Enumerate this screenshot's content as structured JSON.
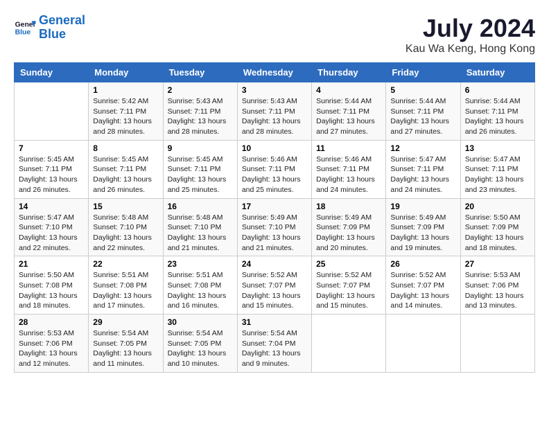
{
  "header": {
    "logo_line1": "General",
    "logo_line2": "Blue",
    "month": "July 2024",
    "location": "Kau Wa Keng, Hong Kong"
  },
  "days_of_week": [
    "Sunday",
    "Monday",
    "Tuesday",
    "Wednesday",
    "Thursday",
    "Friday",
    "Saturday"
  ],
  "weeks": [
    [
      {
        "num": "",
        "sunrise": "",
        "sunset": "",
        "daylight": ""
      },
      {
        "num": "1",
        "sunrise": "Sunrise: 5:42 AM",
        "sunset": "Sunset: 7:11 PM",
        "daylight": "Daylight: 13 hours and 28 minutes."
      },
      {
        "num": "2",
        "sunrise": "Sunrise: 5:43 AM",
        "sunset": "Sunset: 7:11 PM",
        "daylight": "Daylight: 13 hours and 28 minutes."
      },
      {
        "num": "3",
        "sunrise": "Sunrise: 5:43 AM",
        "sunset": "Sunset: 7:11 PM",
        "daylight": "Daylight: 13 hours and 28 minutes."
      },
      {
        "num": "4",
        "sunrise": "Sunrise: 5:44 AM",
        "sunset": "Sunset: 7:11 PM",
        "daylight": "Daylight: 13 hours and 27 minutes."
      },
      {
        "num": "5",
        "sunrise": "Sunrise: 5:44 AM",
        "sunset": "Sunset: 7:11 PM",
        "daylight": "Daylight: 13 hours and 27 minutes."
      },
      {
        "num": "6",
        "sunrise": "Sunrise: 5:44 AM",
        "sunset": "Sunset: 7:11 PM",
        "daylight": "Daylight: 13 hours and 26 minutes."
      }
    ],
    [
      {
        "num": "7",
        "sunrise": "Sunrise: 5:45 AM",
        "sunset": "Sunset: 7:11 PM",
        "daylight": "Daylight: 13 hours and 26 minutes."
      },
      {
        "num": "8",
        "sunrise": "Sunrise: 5:45 AM",
        "sunset": "Sunset: 7:11 PM",
        "daylight": "Daylight: 13 hours and 26 minutes."
      },
      {
        "num": "9",
        "sunrise": "Sunrise: 5:45 AM",
        "sunset": "Sunset: 7:11 PM",
        "daylight": "Daylight: 13 hours and 25 minutes."
      },
      {
        "num": "10",
        "sunrise": "Sunrise: 5:46 AM",
        "sunset": "Sunset: 7:11 PM",
        "daylight": "Daylight: 13 hours and 25 minutes."
      },
      {
        "num": "11",
        "sunrise": "Sunrise: 5:46 AM",
        "sunset": "Sunset: 7:11 PM",
        "daylight": "Daylight: 13 hours and 24 minutes."
      },
      {
        "num": "12",
        "sunrise": "Sunrise: 5:47 AM",
        "sunset": "Sunset: 7:11 PM",
        "daylight": "Daylight: 13 hours and 24 minutes."
      },
      {
        "num": "13",
        "sunrise": "Sunrise: 5:47 AM",
        "sunset": "Sunset: 7:11 PM",
        "daylight": "Daylight: 13 hours and 23 minutes."
      }
    ],
    [
      {
        "num": "14",
        "sunrise": "Sunrise: 5:47 AM",
        "sunset": "Sunset: 7:10 PM",
        "daylight": "Daylight: 13 hours and 22 minutes."
      },
      {
        "num": "15",
        "sunrise": "Sunrise: 5:48 AM",
        "sunset": "Sunset: 7:10 PM",
        "daylight": "Daylight: 13 hours and 22 minutes."
      },
      {
        "num": "16",
        "sunrise": "Sunrise: 5:48 AM",
        "sunset": "Sunset: 7:10 PM",
        "daylight": "Daylight: 13 hours and 21 minutes."
      },
      {
        "num": "17",
        "sunrise": "Sunrise: 5:49 AM",
        "sunset": "Sunset: 7:10 PM",
        "daylight": "Daylight: 13 hours and 21 minutes."
      },
      {
        "num": "18",
        "sunrise": "Sunrise: 5:49 AM",
        "sunset": "Sunset: 7:09 PM",
        "daylight": "Daylight: 13 hours and 20 minutes."
      },
      {
        "num": "19",
        "sunrise": "Sunrise: 5:49 AM",
        "sunset": "Sunset: 7:09 PM",
        "daylight": "Daylight: 13 hours and 19 minutes."
      },
      {
        "num": "20",
        "sunrise": "Sunrise: 5:50 AM",
        "sunset": "Sunset: 7:09 PM",
        "daylight": "Daylight: 13 hours and 18 minutes."
      }
    ],
    [
      {
        "num": "21",
        "sunrise": "Sunrise: 5:50 AM",
        "sunset": "Sunset: 7:08 PM",
        "daylight": "Daylight: 13 hours and 18 minutes."
      },
      {
        "num": "22",
        "sunrise": "Sunrise: 5:51 AM",
        "sunset": "Sunset: 7:08 PM",
        "daylight": "Daylight: 13 hours and 17 minutes."
      },
      {
        "num": "23",
        "sunrise": "Sunrise: 5:51 AM",
        "sunset": "Sunset: 7:08 PM",
        "daylight": "Daylight: 13 hours and 16 minutes."
      },
      {
        "num": "24",
        "sunrise": "Sunrise: 5:52 AM",
        "sunset": "Sunset: 7:07 PM",
        "daylight": "Daylight: 13 hours and 15 minutes."
      },
      {
        "num": "25",
        "sunrise": "Sunrise: 5:52 AM",
        "sunset": "Sunset: 7:07 PM",
        "daylight": "Daylight: 13 hours and 15 minutes."
      },
      {
        "num": "26",
        "sunrise": "Sunrise: 5:52 AM",
        "sunset": "Sunset: 7:07 PM",
        "daylight": "Daylight: 13 hours and 14 minutes."
      },
      {
        "num": "27",
        "sunrise": "Sunrise: 5:53 AM",
        "sunset": "Sunset: 7:06 PM",
        "daylight": "Daylight: 13 hours and 13 minutes."
      }
    ],
    [
      {
        "num": "28",
        "sunrise": "Sunrise: 5:53 AM",
        "sunset": "Sunset: 7:06 PM",
        "daylight": "Daylight: 13 hours and 12 minutes."
      },
      {
        "num": "29",
        "sunrise": "Sunrise: 5:54 AM",
        "sunset": "Sunset: 7:05 PM",
        "daylight": "Daylight: 13 hours and 11 minutes."
      },
      {
        "num": "30",
        "sunrise": "Sunrise: 5:54 AM",
        "sunset": "Sunset: 7:05 PM",
        "daylight": "Daylight: 13 hours and 10 minutes."
      },
      {
        "num": "31",
        "sunrise": "Sunrise: 5:54 AM",
        "sunset": "Sunset: 7:04 PM",
        "daylight": "Daylight: 13 hours and 9 minutes."
      },
      {
        "num": "",
        "sunrise": "",
        "sunset": "",
        "daylight": ""
      },
      {
        "num": "",
        "sunrise": "",
        "sunset": "",
        "daylight": ""
      },
      {
        "num": "",
        "sunrise": "",
        "sunset": "",
        "daylight": ""
      }
    ]
  ]
}
